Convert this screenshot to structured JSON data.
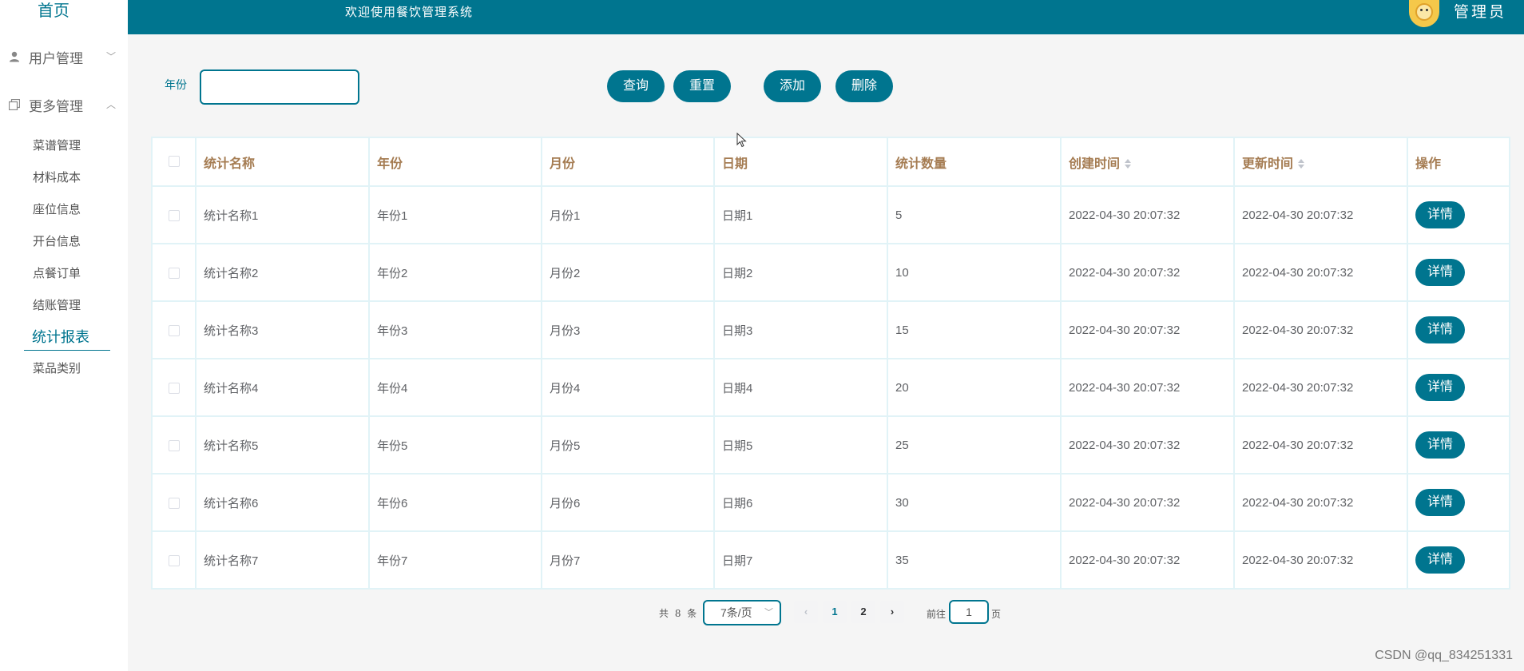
{
  "sidebar": {
    "home": "首页",
    "groups": [
      {
        "label": "用户管理",
        "chevron": "﹀"
      },
      {
        "label": "更多管理",
        "chevron": "︿"
      }
    ],
    "items": [
      {
        "label": "菜谱管理"
      },
      {
        "label": "材料成本"
      },
      {
        "label": "座位信息"
      },
      {
        "label": "开台信息"
      },
      {
        "label": "点餐订单"
      },
      {
        "label": "结账管理"
      },
      {
        "label": "统计报表"
      },
      {
        "label": "菜品类别"
      }
    ],
    "active": "统计报表"
  },
  "header": {
    "title": "欢迎使用餐饮管理系统",
    "user": "管理员"
  },
  "search": {
    "year_label": "年份",
    "year_value": "",
    "query_label": "查询",
    "reset_label": "重置",
    "add_label": "添加",
    "delete_label": "删除"
  },
  "table": {
    "columns": [
      "统计名称",
      "年份",
      "月份",
      "日期",
      "统计数量",
      "创建时间",
      "更新时间",
      "操作"
    ],
    "sortable_columns": [
      "创建时间",
      "更新时间"
    ],
    "rows": [
      {
        "name": "统计名称1",
        "year": "年份1",
        "month": "月份1",
        "date": "日期1",
        "count": "5",
        "created": "2022-04-30 20:07:32",
        "updated": "2022-04-30 20:07:32",
        "action": "详情"
      },
      {
        "name": "统计名称2",
        "year": "年份2",
        "month": "月份2",
        "date": "日期2",
        "count": "10",
        "created": "2022-04-30 20:07:32",
        "updated": "2022-04-30 20:07:32",
        "action": "详情"
      },
      {
        "name": "统计名称3",
        "year": "年份3",
        "month": "月份3",
        "date": "日期3",
        "count": "15",
        "created": "2022-04-30 20:07:32",
        "updated": "2022-04-30 20:07:32",
        "action": "详情"
      },
      {
        "name": "统计名称4",
        "year": "年份4",
        "month": "月份4",
        "date": "日期4",
        "count": "20",
        "created": "2022-04-30 20:07:32",
        "updated": "2022-04-30 20:07:32",
        "action": "详情"
      },
      {
        "name": "统计名称5",
        "year": "年份5",
        "month": "月份5",
        "date": "日期5",
        "count": "25",
        "created": "2022-04-30 20:07:32",
        "updated": "2022-04-30 20:07:32",
        "action": "详情"
      },
      {
        "name": "统计名称6",
        "year": "年份6",
        "month": "月份6",
        "date": "日期6",
        "count": "30",
        "created": "2022-04-30 20:07:32",
        "updated": "2022-04-30 20:07:32",
        "action": "详情"
      },
      {
        "name": "统计名称7",
        "year": "年份7",
        "month": "月份7",
        "date": "日期7",
        "count": "35",
        "created": "2022-04-30 20:07:32",
        "updated": "2022-04-30 20:07:32",
        "action": "详情"
      }
    ]
  },
  "pagination": {
    "total_text": "共 8 条",
    "page_size": "7条/页",
    "pages": [
      "1",
      "2"
    ],
    "current_page": "1",
    "prev_icon": "‹",
    "next_icon": "›",
    "goto_label": "前往",
    "goto_value": "1",
    "goto_unit": "页"
  },
  "watermark": "CSDN @qq_834251331",
  "colors": {
    "accent": "#00758f",
    "header_text": "#a57c52",
    "background": "#f5f5f5"
  }
}
